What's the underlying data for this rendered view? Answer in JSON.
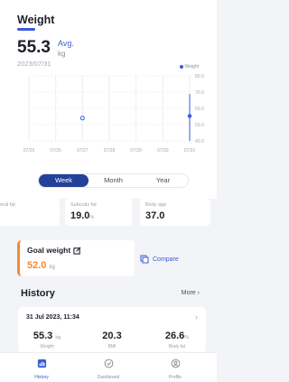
{
  "header": {
    "title": "Weight",
    "value": "55.3",
    "avg_label": "Avg.",
    "unit": "kg",
    "date": "2023/07/31"
  },
  "chart_data": {
    "type": "scatter",
    "legend": "Weight",
    "x": [
      "07/25",
      "07/26",
      "07/27",
      "07/28",
      "07/29",
      "07/30",
      "07/31"
    ],
    "yticks": [
      "80.0",
      "70.0",
      "60.0",
      "50.0",
      "40.0"
    ],
    "ylim": [
      40,
      80
    ],
    "points": [
      {
        "x": "07/27",
        "y": 54.0,
        "style": "hollow"
      },
      {
        "x": "07/31",
        "y": 55.3,
        "style": "filled",
        "selected": true
      }
    ],
    "legend_position": "top-right"
  },
  "period_tabs": [
    {
      "label": "Week",
      "active": true
    },
    {
      "label": "Month",
      "active": false
    },
    {
      "label": "Year",
      "active": false
    }
  ],
  "stats": {
    "visceral": {
      "label": "eral fat"
    },
    "subcutaneous": {
      "label": "Subcutis fat",
      "value": "19.0",
      "unit": "%"
    },
    "body_age": {
      "label": "Body age",
      "value": "37.0"
    }
  },
  "goal": {
    "title": "Goal weight",
    "value": "52.0",
    "unit": "kg"
  },
  "compare_label": "Compare",
  "history": {
    "title": "History",
    "more_label": "More",
    "chevron": "›",
    "record": {
      "date": "31 Jul 2023, 11:34",
      "weight": {
        "value": "55.3",
        "unit": "kg",
        "label": "Weight"
      },
      "bmi": {
        "value": "20.3",
        "label": "BMI"
      },
      "body_fat": {
        "value": "26.6",
        "unit": "%",
        "label": "Body fat"
      }
    }
  },
  "tabbar": [
    {
      "label": "History",
      "icon": "history-icon",
      "active": true
    },
    {
      "label": "Dashboard",
      "icon": "dashboard-icon",
      "active": false
    },
    {
      "label": "Profile",
      "icon": "profile-icon",
      "active": false
    }
  ],
  "colors": {
    "accent": "#3a5bd9",
    "navy": "#23409a",
    "orange": "#f18a33"
  }
}
